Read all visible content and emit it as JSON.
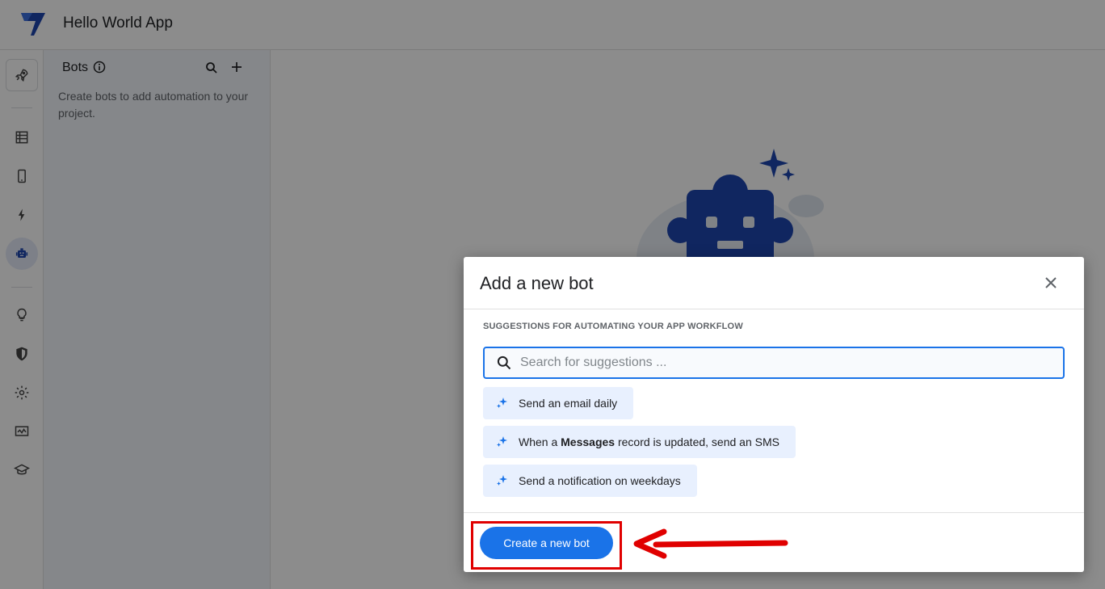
{
  "header": {
    "app_title": "Hello World App"
  },
  "rail": {
    "items": [
      {
        "icon": "rocket-icon"
      },
      {
        "icon": "table-icon"
      },
      {
        "icon": "phone-icon"
      },
      {
        "icon": "lightning-icon"
      },
      {
        "icon": "robot-icon",
        "active": true
      },
      {
        "icon": "lightbulb-icon"
      },
      {
        "icon": "shield-icon"
      },
      {
        "icon": "gear-icon"
      },
      {
        "icon": "monitor-icon"
      },
      {
        "icon": "graduation-cap-icon"
      }
    ]
  },
  "panel": {
    "title": "Bots",
    "description": "Create bots to add automation to your project."
  },
  "dialog": {
    "title": "Add a new bot",
    "section_label": "SUGGESTIONS FOR AUTOMATING YOUR APP WORKFLOW",
    "search_placeholder": "Search for suggestions ...",
    "suggestions": [
      {
        "pre": "Send an email daily",
        "bold": "",
        "post": ""
      },
      {
        "pre": "When a ",
        "bold": "Messages",
        "post": " record is updated, send an SMS"
      },
      {
        "pre": "Send a notification on weekdays",
        "bold": "",
        "post": ""
      }
    ],
    "create_label": "Create a new bot"
  },
  "colors": {
    "accent": "#1a73e8",
    "chip_bg": "#e8f0fe",
    "robot": "#1e46b0",
    "annotation": "#e00000"
  }
}
